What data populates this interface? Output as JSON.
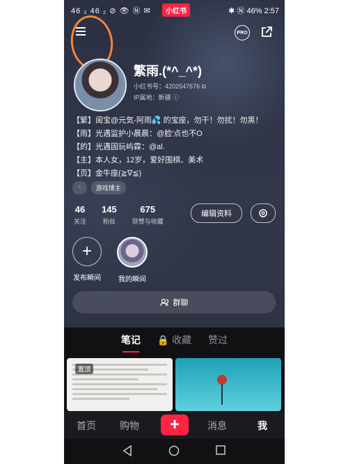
{
  "status_bar": {
    "left": "46 ₂ 46 ₂ ⊘ 👁 Ⓝ ✉",
    "logo": "小红书",
    "right": "✱ Ⓝ 46%",
    "time": "2:57"
  },
  "header": {
    "pro_label": "PRO"
  },
  "profile": {
    "name": "繁雨.(*^_^*)",
    "uid_line": "小红书号：4202547676 ⧉",
    "ip_line": "IP属地：新疆 ⓘ"
  },
  "bio": [
    "【繁】闺宝@元気-阿雨💦 的宝座，勿干！勿扰！勿黑！",
    "【雨】光遇监护小晨晨：@脸'点也不O",
    "【的】光遇固玩屿霖：@al.",
    "【主】本人女，12岁，爱好围棋、美术",
    "【页】金牛座(≧∇≦)"
  ],
  "tags": [
    "♀",
    "游戏博主"
  ],
  "stats": [
    {
      "num": "46",
      "label": "关注"
    },
    {
      "num": "145",
      "label": "粉丝"
    },
    {
      "num": "675",
      "label": "获赞与收藏"
    }
  ],
  "buttons": {
    "edit_profile": "编辑资料",
    "group_chat": "群聊"
  },
  "moments": {
    "publish": "发布瞬间",
    "mine": "我的瞬间"
  },
  "tabs": [
    "笔记",
    "🔒 收藏",
    "赞过"
  ],
  "notes": {
    "badge": "置顶"
  },
  "bottom_nav": [
    "首页",
    "购物",
    "消息",
    "我"
  ],
  "colors": {
    "accent": "#ff2442",
    "background": "#2c3143"
  }
}
